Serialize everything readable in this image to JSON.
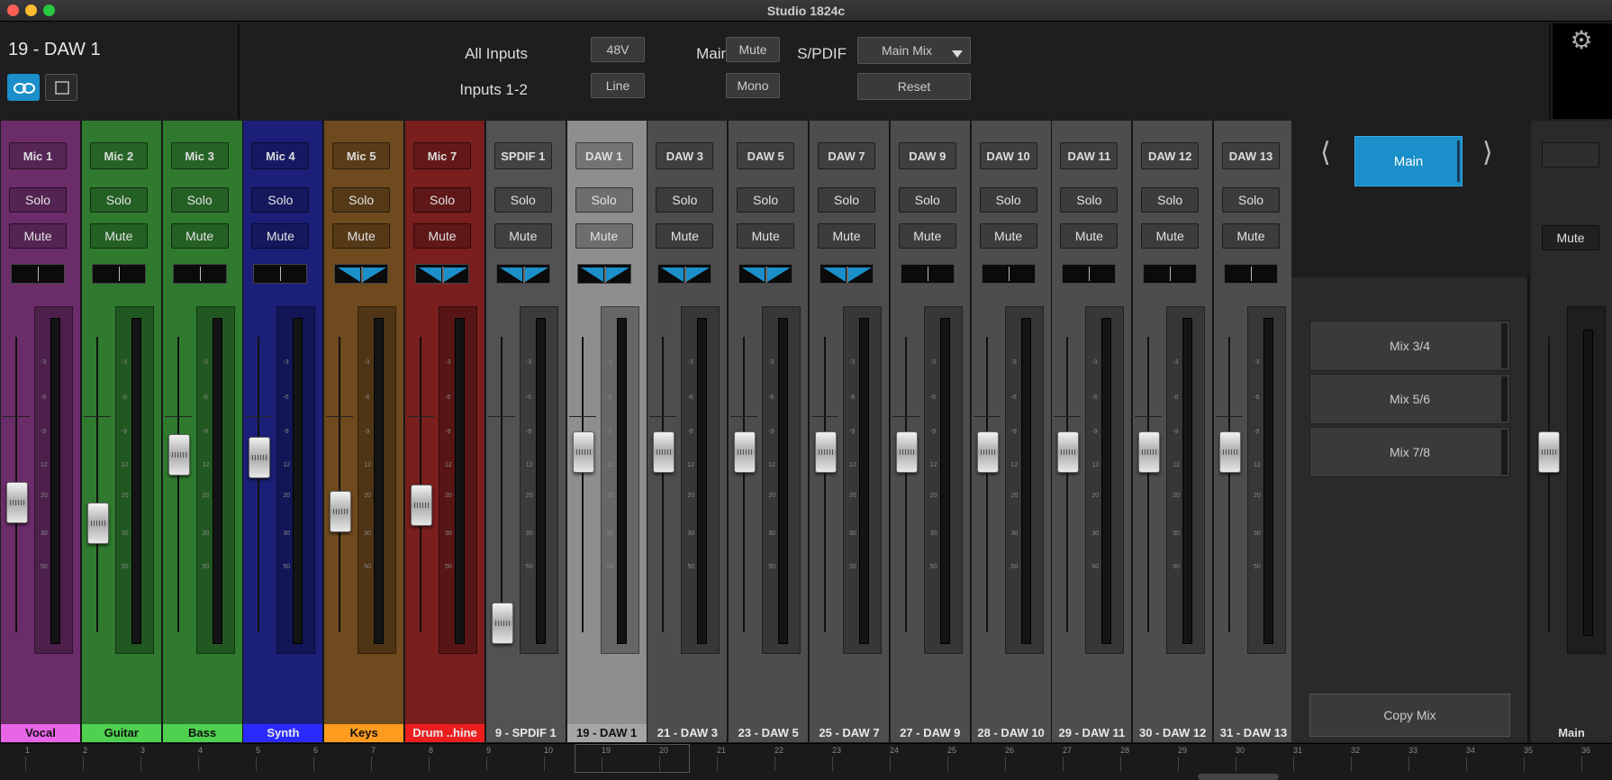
{
  "window": {
    "title": "Studio 1824c"
  },
  "selection": {
    "title": "19 - DAW 1"
  },
  "top": {
    "all_inputs_label": "All Inputs",
    "phantom_label": "48V",
    "inputs12_label": "Inputs 1-2",
    "line_label": "Line",
    "main_label": "Main",
    "mute_label": "Mute",
    "mono_label": "Mono",
    "spdif_label": "S/PDIF",
    "spdif_value": "Main Mix",
    "reset_label": "Reset"
  },
  "strip_labels": {
    "solo": "Solo",
    "mute": "Mute"
  },
  "strips": [
    {
      "name": "Mic 1",
      "label": "Vocal",
      "color": "#6b2d6a",
      "label_color": "#e865e8",
      "panned": false,
      "fader": 0.44
    },
    {
      "name": "Mic 2",
      "label": "Guitar",
      "color": "#2f7a2f",
      "label_color": "#4fd14f",
      "panned": false,
      "fader": 0.37
    },
    {
      "name": "Mic 3",
      "label": "Bass",
      "color": "#2f7a2f",
      "label_color": "#4fd14f",
      "panned": false,
      "fader": 0.6
    },
    {
      "name": "Mic 4",
      "label": "Synth",
      "color": "#1b1f78",
      "label_color": "#2a2aff",
      "panned": false,
      "fader": 0.59
    },
    {
      "name": "Mic 5",
      "label": "Keys",
      "color": "#6e4a1e",
      "label_color": "#ff9b1f",
      "panned": true,
      "fader": 0.41
    },
    {
      "name": "Mic 7",
      "label": "Drum ..hine",
      "color": "#7a1e1e",
      "label_color": "#ee1e1e",
      "panned": true,
      "fader": 0.43
    },
    {
      "name": "SPDIF 1",
      "label": "9 - SPDIF 1",
      "color": "#525254",
      "label_color": "#525254",
      "panned": true,
      "fader": 0.03
    },
    {
      "name": "DAW 1",
      "label": "19 - DAW 1",
      "color": "#8e8e90",
      "label_color": "#a6a6a8",
      "panned": true,
      "fader": 0.61
    },
    {
      "name": "DAW 3",
      "label": "21 - DAW 3",
      "color": "#4d4d4f",
      "label_color": "#4d4d4f",
      "panned": true,
      "fader": 0.61
    },
    {
      "name": "DAW 5",
      "label": "23 - DAW 5",
      "color": "#4d4d4f",
      "label_color": "#4d4d4f",
      "panned": true,
      "fader": 0.61
    },
    {
      "name": "DAW 7",
      "label": "25 - DAW 7",
      "color": "#4d4d4f",
      "label_color": "#4d4d4f",
      "panned": true,
      "fader": 0.61
    },
    {
      "name": "DAW 9",
      "label": "27 - DAW 9",
      "color": "#4d4d4f",
      "label_color": "#4d4d4f",
      "panned": false,
      "fader": 0.61
    },
    {
      "name": "DAW 10",
      "label": "28 - DAW 10",
      "color": "#4d4d4f",
      "label_color": "#4d4d4f",
      "panned": false,
      "fader": 0.61
    },
    {
      "name": "DAW 11",
      "label": "29 - DAW 11",
      "color": "#4d4d4f",
      "label_color": "#4d4d4f",
      "panned": false,
      "fader": 0.61
    },
    {
      "name": "DAW 12",
      "label": "30 - DAW 12",
      "color": "#4d4d4f",
      "label_color": "#4d4d4f",
      "panned": false,
      "fader": 0.61
    },
    {
      "name": "DAW 13",
      "label": "31 - DAW 13",
      "color": "#4d4d4f",
      "label_color": "#4d4d4f",
      "panned": false,
      "fader": 0.61
    }
  ],
  "meter_ticks": [
    "-3",
    "-6",
    "-9",
    "12",
    "20",
    "30",
    "50"
  ],
  "mix": {
    "current": "Main",
    "items": [
      "Mix 3/4",
      "Mix 5/6",
      "Mix 7/8"
    ],
    "copy_label": "Copy Mix"
  },
  "main_strip": {
    "mute_label": "Mute",
    "label": "Main",
    "fader": 0.61
  },
  "channel_numbers": [
    "1",
    "2",
    "3",
    "4",
    "5",
    "6",
    "7",
    "8",
    "9",
    "10",
    "19",
    "20",
    "21",
    "22",
    "23",
    "24",
    "25",
    "26",
    "27",
    "28",
    "29",
    "30",
    "31",
    "32",
    "33",
    "34",
    "35",
    "36"
  ],
  "colors": {
    "accent": "#1a8fc9"
  },
  "icons": {
    "link": "link-icon",
    "single": "single-view-icon",
    "settings": "gear-icon"
  }
}
